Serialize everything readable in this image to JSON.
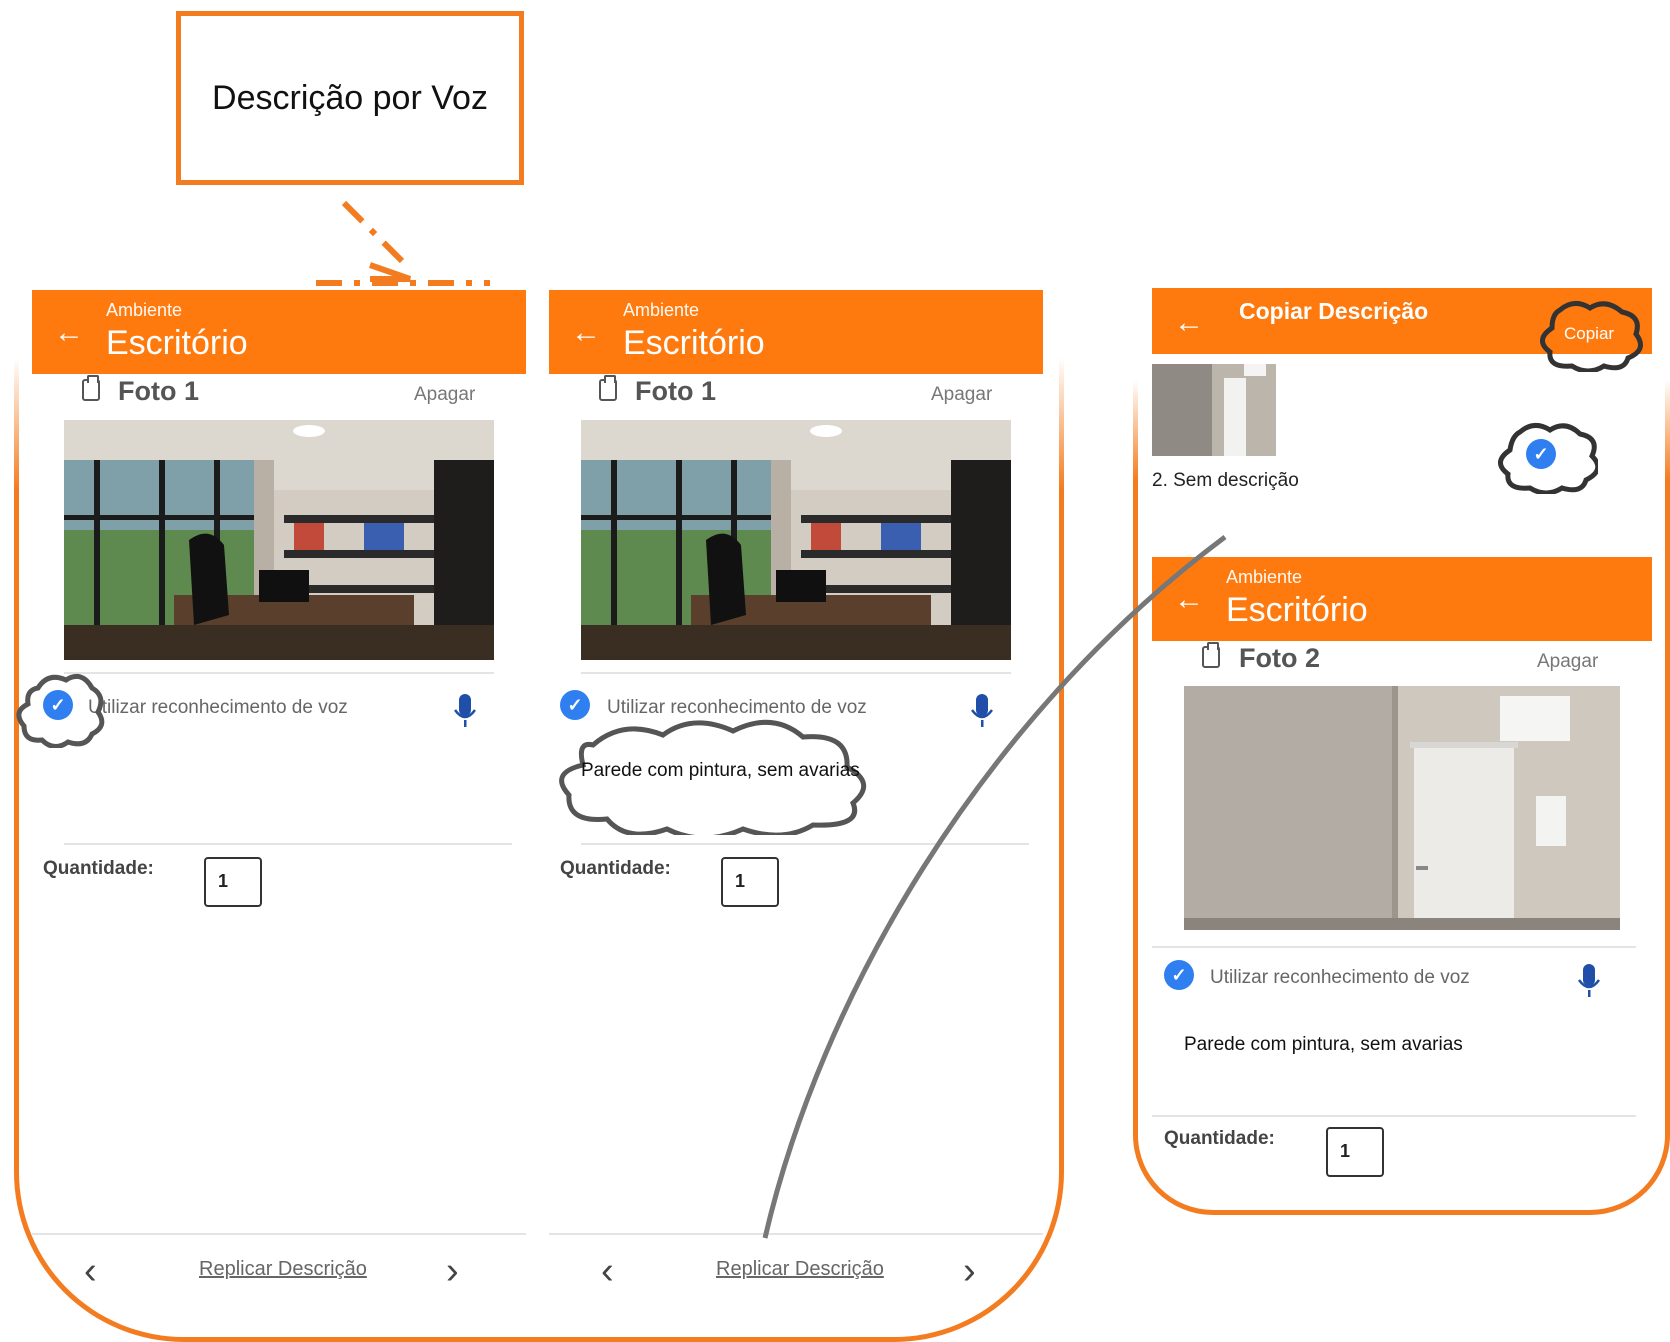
{
  "callout": {
    "label": "Descrição por Voz"
  },
  "screen1": {
    "header_sub": "Ambiente",
    "header_title": "Escritório",
    "foto_label": "Foto 1",
    "delete_label": "Apagar",
    "voice_label": "Utilizar reconhecimento de voz",
    "quantity_label": "Quantidade:",
    "quantity_value": "1",
    "replicate_label": "Replicar Descrição"
  },
  "screen2": {
    "header_sub": "Ambiente",
    "header_title": "Escritório",
    "foto_label": "Foto 1",
    "delete_label": "Apagar",
    "voice_label": "Utilizar reconhecimento de voz",
    "description": "Parede com pintura, sem avarias",
    "quantity_label": "Quantidade:",
    "quantity_value": "1",
    "replicate_label": "Replicar Descrição"
  },
  "copy_dialog": {
    "title": "Copiar Descrição",
    "copy_button": "Copiar",
    "item_caption": "2. Sem descrição"
  },
  "screen3": {
    "header_sub": "Ambiente",
    "header_title": "Escritório",
    "foto_label": "Foto 2",
    "delete_label": "Apagar",
    "voice_label": "Utilizar reconhecimento de voz",
    "description": "Parede com pintura, sem avarias",
    "quantity_label": "Quantidade:",
    "quantity_value": "1"
  },
  "colors": {
    "accent": "#ff7a0e",
    "outline": "#f47c20",
    "check": "#2f7ff0",
    "mic": "#1f4fa8"
  },
  "icons": [
    "back-arrow-icon",
    "clipboard-icon",
    "check-icon",
    "microphone-icon",
    "chevron-left-icon",
    "chevron-right-icon"
  ]
}
